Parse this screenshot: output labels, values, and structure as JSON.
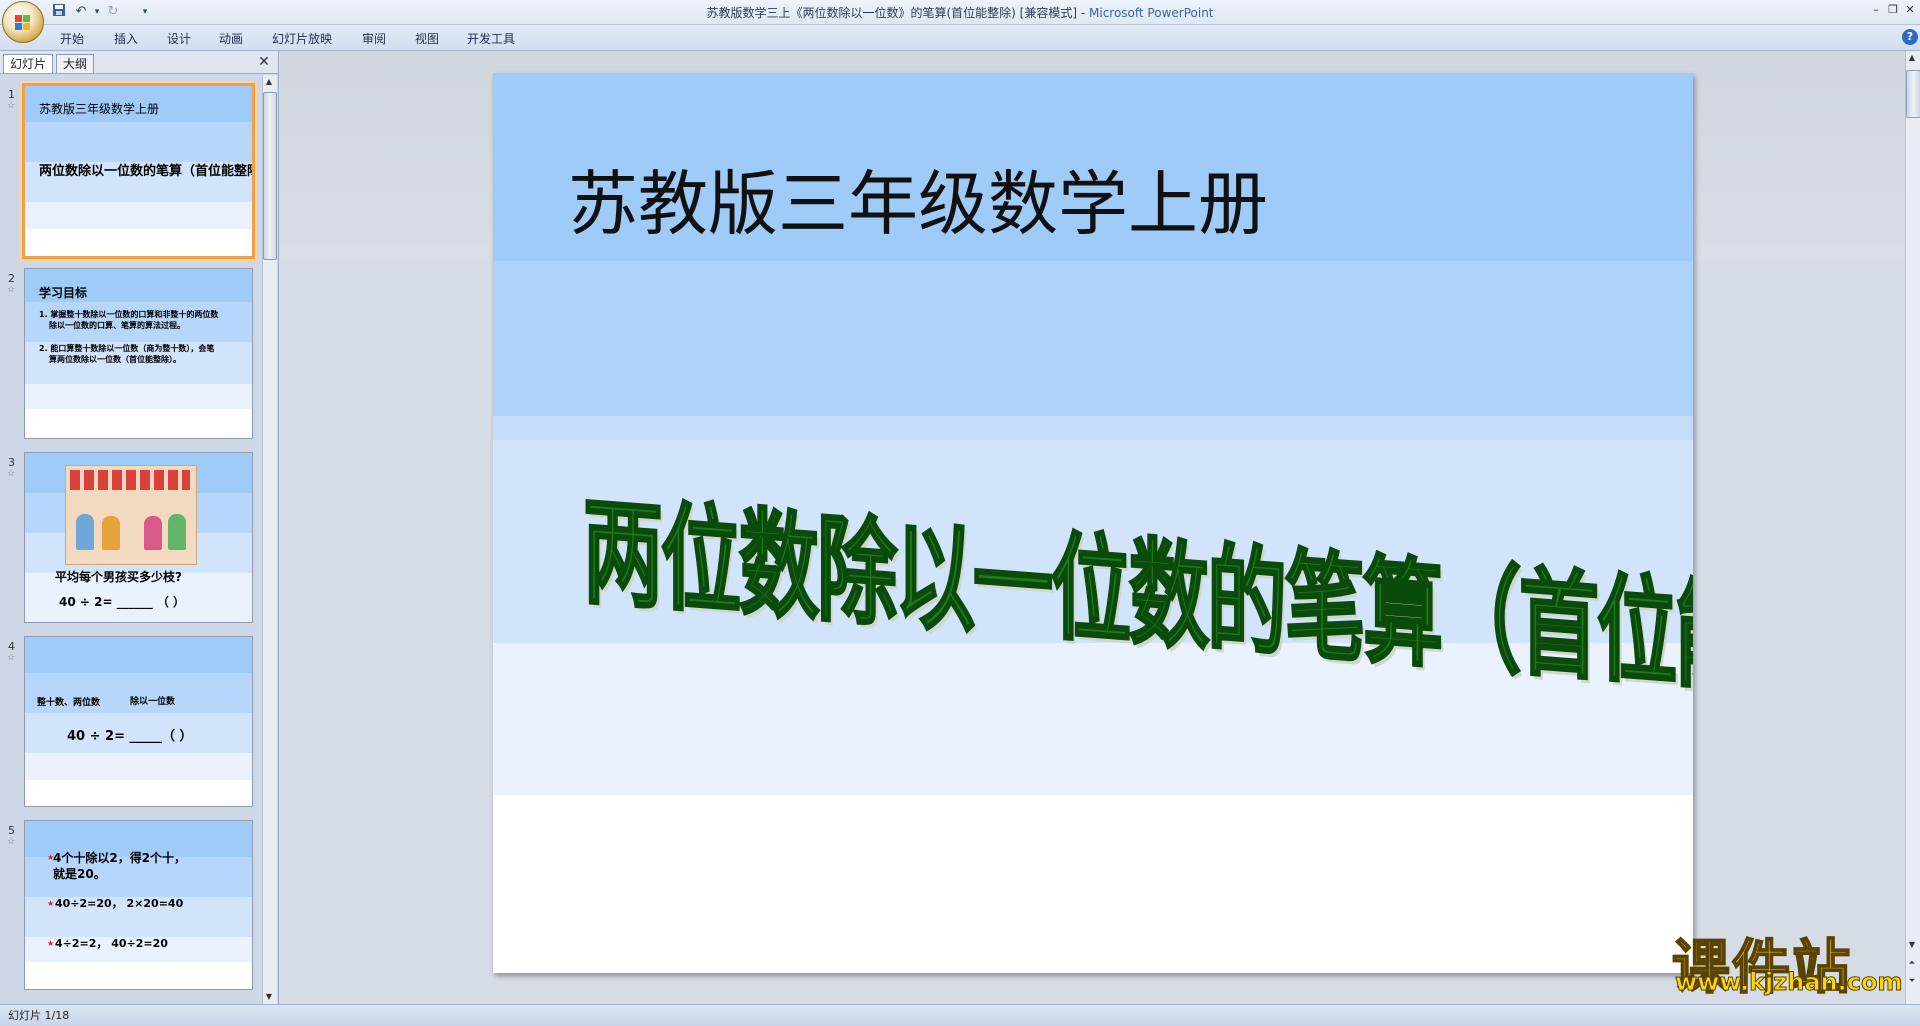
{
  "window": {
    "title_doc": "苏教版数学三上《两位数除以一位数》的笔算(首位能整除) [兼容模式] - ",
    "title_app": "Microsoft PowerPoint"
  },
  "quick_access": [
    "save-icon",
    "undo-icon",
    "redo-icon",
    "customize-icon"
  ],
  "ribbon_tabs": [
    "开始",
    "插入",
    "设计",
    "动画",
    "幻灯片放映",
    "审阅",
    "视图",
    "开发工具"
  ],
  "pane": {
    "tab_slides": "幻灯片",
    "tab_outline": "大纲"
  },
  "thumbnails": [
    {
      "num": "1",
      "line1": "苏教版三年级数学上册",
      "line2": "两位数除以一位数的笔算（首位能整除）"
    },
    {
      "num": "2",
      "heading": "学习目标",
      "item1a": "1. 掌握整十数除以一位数的口算和非整十的两位数",
      "item1b": "除以一位数的口算、笔算的算法过程。",
      "item2a": "2. 能口算整十数除以一位数（商为整十数），会笔",
      "item2b": "算两位数除以一位数（首位能整除）。"
    },
    {
      "num": "3",
      "question": "平均每个男孩买多少枝?",
      "equation": "40 ÷ 2= ______ （    ）"
    },
    {
      "num": "4",
      "label1": "整十数、两位数",
      "label2": "除以一位数",
      "equation": "40 ÷  2= _____（    ）"
    },
    {
      "num": "5",
      "line1": "4个十除以2，得2个十，",
      "line2": "就是20。",
      "line3": "40÷2=20， 2×20=40",
      "line4": "4÷2=2， 40÷2=20"
    }
  ],
  "slide": {
    "title": "苏教版三年级数学上册",
    "subtitle": "两位数除以一位数的笔算（首位能整除）"
  },
  "status": {
    "slide_counter": "幻灯片 1/18"
  },
  "watermark": {
    "name": "课件站",
    "url": "www.kjzhan.com"
  },
  "colors": {
    "band1": "#9fcbf9",
    "band2": "#b6d6fb",
    "band3": "#d1e4fc",
    "band4": "#e9f2fe",
    "subtitle_green": "#1e7a1e",
    "selection_orange": "#f0a04c"
  }
}
